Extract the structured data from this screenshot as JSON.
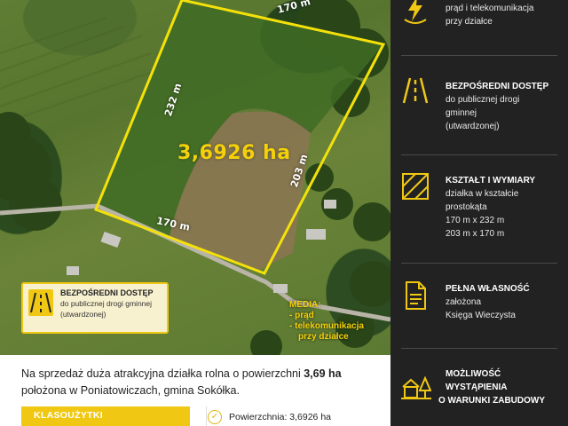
{
  "map": {
    "area_label": "3,6926 ha",
    "dim_top": "170 m",
    "dim_left": "232 m",
    "dim_right": "203 m",
    "dim_bottom": "170 m"
  },
  "access_card": {
    "title": "BEZPOŚREDNI DOSTĘP",
    "line1": "do publicznej drogi gminnej",
    "line2": "(utwardzonej)"
  },
  "media_note": {
    "title": "MEDIA:",
    "item1": "- prąd",
    "item2": "- telekomunikacja",
    "item3": "przy działce"
  },
  "description": {
    "part1": "Na sprzedaż duża atrakcyjna działka rolna o powierzchni ",
    "bold": "3,69 ha",
    "part2": " położona w Poniatowiczach, gmina Sokółka."
  },
  "klasouzytki_label": "KLASOUŻYTKI",
  "area_row": {
    "label": "Powierzchnia: 3,6926 ha"
  },
  "sidebar": {
    "media": {
      "line1": "prąd i telekomunikacja",
      "line2": "przy działce"
    },
    "access": {
      "title": "BEZPOŚREDNI DOSTĘP",
      "line1": "do publicznej drogi",
      "line2": "gminnej",
      "line3": "(utwardzonej)"
    },
    "shape": {
      "title": "KSZTAŁT I WYMIARY",
      "line1": "działka w kształcie",
      "line2": "prostokąta",
      "line3": "170 m x 232 m",
      "line4": "203 m x 170 m"
    },
    "ownership": {
      "title": "PEŁNA WŁASNOŚĆ",
      "line1": "założona",
      "line2": "Księga Wieczysta"
    },
    "building": {
      "title1": "MOŻLIWOŚĆ",
      "title2": "WYSTĄPIENIA",
      "title3": "O WARUNKI ZABUDOWY"
    }
  },
  "colors": {
    "accent": "#f0c814",
    "sidebar_bg": "#222222",
    "plot_outline": "#f5e10a"
  }
}
